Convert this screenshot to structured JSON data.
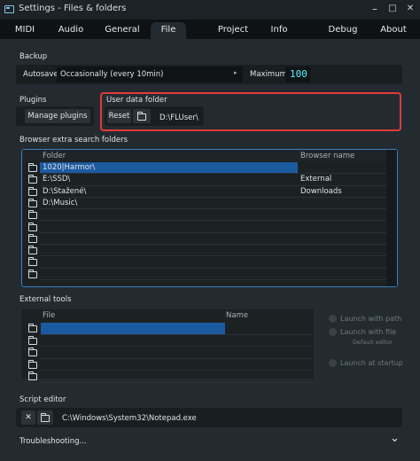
{
  "window": {
    "title": "Settings - Files & folders",
    "minimize": "–",
    "maximize": "□",
    "close": "✕"
  },
  "tabs": [
    {
      "label": "MIDI"
    },
    {
      "label": "Audio"
    },
    {
      "label": "General"
    },
    {
      "label": "File"
    },
    {
      "label": "Project"
    },
    {
      "label": "Info"
    },
    {
      "label": "Debug"
    },
    {
      "label": "About"
    }
  ],
  "active_tab": "File",
  "backup": {
    "title": "Backup",
    "autosave_label": "Autosave",
    "autosave_value": "Occasionally (every 10min)",
    "maximum_label": "Maximum",
    "maximum_value": "100"
  },
  "plugins": {
    "title": "Plugins",
    "manage_button": "Manage plugins"
  },
  "user_data": {
    "title": "User data folder",
    "reset_button": "Reset",
    "path": "D:\\FLUser\\",
    "highlight_color": "#e23a3a"
  },
  "browser_folders": {
    "title": "Browser extra search folders",
    "columns": {
      "folder": "Folder",
      "name": "Browser name"
    },
    "rows": [
      {
        "folder": "1020|Harmor\\",
        "name": "",
        "selected": true
      },
      {
        "folder": "E:\\SSD\\",
        "name": "External",
        "selected": false
      },
      {
        "folder": "D:\\Stažené\\",
        "name": "Downloads",
        "selected": false
      },
      {
        "folder": "D:\\Music\\",
        "name": "",
        "selected": false
      },
      {
        "folder": "",
        "name": "",
        "selected": false
      },
      {
        "folder": "",
        "name": "",
        "selected": false
      },
      {
        "folder": "",
        "name": "",
        "selected": false
      },
      {
        "folder": "",
        "name": "",
        "selected": false
      },
      {
        "folder": "",
        "name": "",
        "selected": false
      },
      {
        "folder": "",
        "name": "",
        "selected": false
      }
    ]
  },
  "external_tools": {
    "title": "External tools",
    "columns": {
      "file": "File",
      "name": "Name"
    },
    "rows": 5,
    "launch_with_path": "Launch with path",
    "launch_with_file": "Launch with file",
    "default_editor": "Default editor",
    "launch_at_startup": "Launch at startup"
  },
  "script_editor": {
    "title": "Script editor",
    "clear": "✕",
    "path": "C:\\Windows\\System32\\Notepad.exe"
  },
  "troubleshooting": {
    "label": "Troubleshooting...",
    "chevron": "⌄"
  },
  "colors": {
    "accent_blue": "#1c5aa0",
    "maximum_value": "#5ff2ff",
    "background": "#242b30"
  }
}
